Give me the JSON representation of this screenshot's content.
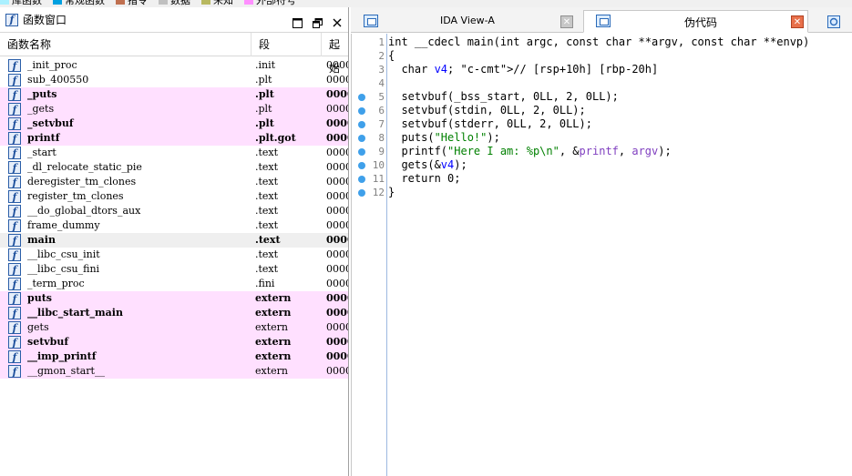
{
  "legend": [
    {
      "label": "库函数",
      "color": "#aaf0ff"
    },
    {
      "label": "常规函数",
      "color": "#00a0e0"
    },
    {
      "label": "指令",
      "color": "#c07050"
    },
    {
      "label": "数据",
      "color": "#c0c0c0"
    },
    {
      "label": "未知",
      "color": "#b8b860"
    },
    {
      "label": "外部符号",
      "color": "#ff90ff"
    }
  ],
  "functions_panel": {
    "title": "函数窗口",
    "columns": {
      "name": "函数名称",
      "segment": "段",
      "start": "起始"
    },
    "rows": [
      {
        "name": "_init_proc",
        "segment": ".init",
        "start": "0000",
        "style": "normal"
      },
      {
        "name": "sub_400550",
        "segment": ".plt",
        "start": "0000",
        "style": "normal"
      },
      {
        "name": "_puts",
        "segment": ".plt",
        "start": "0000",
        "style": "bold-pink"
      },
      {
        "name": "_gets",
        "segment": ".plt",
        "start": "0000",
        "style": "pink"
      },
      {
        "name": "_setvbuf",
        "segment": ".plt",
        "start": "0000",
        "style": "bold-pink"
      },
      {
        "name": "printf",
        "segment": ".plt.got",
        "start": "0000",
        "style": "bold-pink"
      },
      {
        "name": "_start",
        "segment": ".text",
        "start": "0000",
        "style": "normal"
      },
      {
        "name": "_dl_relocate_static_pie",
        "segment": ".text",
        "start": "0000",
        "style": "normal"
      },
      {
        "name": "deregister_tm_clones",
        "segment": ".text",
        "start": "0000",
        "style": "normal"
      },
      {
        "name": "register_tm_clones",
        "segment": ".text",
        "start": "0000",
        "style": "normal"
      },
      {
        "name": "__do_global_dtors_aux",
        "segment": ".text",
        "start": "0000",
        "style": "normal"
      },
      {
        "name": "frame_dummy",
        "segment": ".text",
        "start": "0000",
        "style": "normal"
      },
      {
        "name": "main",
        "segment": ".text",
        "start": "0000",
        "style": "bold-selected"
      },
      {
        "name": "__libc_csu_init",
        "segment": ".text",
        "start": "0000",
        "style": "normal"
      },
      {
        "name": "__libc_csu_fini",
        "segment": ".text",
        "start": "0000",
        "style": "normal"
      },
      {
        "name": "_term_proc",
        "segment": ".fini",
        "start": "0000",
        "style": "normal"
      },
      {
        "name": "puts",
        "segment": "extern",
        "start": "0000",
        "style": "bold-pink"
      },
      {
        "name": "__libc_start_main",
        "segment": "extern",
        "start": "0000",
        "style": "bold-pink"
      },
      {
        "name": "gets",
        "segment": "extern",
        "start": "0000",
        "style": "pink"
      },
      {
        "name": "setvbuf",
        "segment": "extern",
        "start": "0000",
        "style": "bold-pink"
      },
      {
        "name": "__imp_printf",
        "segment": "extern",
        "start": "0000",
        "style": "bold-pink"
      },
      {
        "name": "__gmon_start__",
        "segment": "extern",
        "start": "0000",
        "style": "pink"
      }
    ]
  },
  "tabs": {
    "ida_view": "IDA View-A",
    "pseudocode": "伪代码"
  },
  "code_lines": [
    {
      "num": "1",
      "dot": false,
      "html": "int __cdecl main(int argc, const char **argv, const char **envp)"
    },
    {
      "num": "2",
      "dot": false,
      "html": "{"
    },
    {
      "num": "3",
      "dot": false,
      "html": "  char v4; // [rsp+10h] [rbp-20h]"
    },
    {
      "num": "4",
      "dot": false,
      "html": ""
    },
    {
      "num": "5",
      "dot": true,
      "html": "  setvbuf(_bss_start, 0LL, 2, 0LL);"
    },
    {
      "num": "6",
      "dot": true,
      "html": "  setvbuf(stdin, 0LL, 2, 0LL);"
    },
    {
      "num": "7",
      "dot": true,
      "html": "  setvbuf(stderr, 0LL, 2, 0LL);"
    },
    {
      "num": "8",
      "dot": true,
      "html": "  puts(\"Hello!\");"
    },
    {
      "num": "9",
      "dot": true,
      "html": "  printf(\"Here I am: %p\\n\", &printf, argv);"
    },
    {
      "num": "10",
      "dot": true,
      "html": "  gets(&v4);"
    },
    {
      "num": "11",
      "dot": true,
      "html": "  return 0;"
    },
    {
      "num": "12",
      "dot": true,
      "html": "}"
    }
  ]
}
